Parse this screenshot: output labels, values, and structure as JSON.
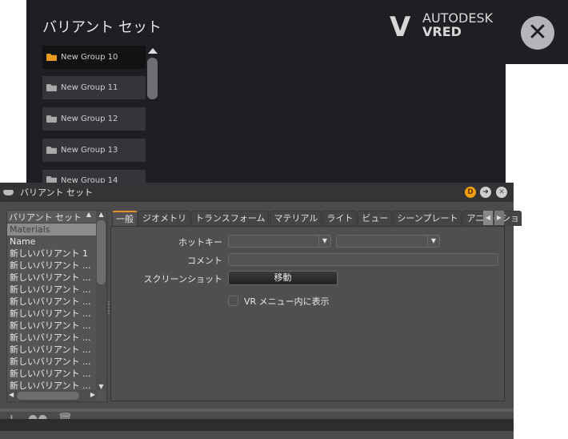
{
  "overlay": {
    "title": "バリアント セット",
    "groups": [
      "New Group 10",
      "New Group 11",
      "New Group 12",
      "New Group 13",
      "New Group 14"
    ],
    "logo": {
      "mark": "V",
      "brand": "AUTODESK",
      "product": "VRED"
    }
  },
  "window": {
    "title": "バリアント セット",
    "buttons": {
      "d": "D",
      "arrow": "➜",
      "close": "✕"
    },
    "list": {
      "header": "バリアント セット",
      "items": [
        "Materials",
        "Name",
        "新しいバリアント 1",
        "新しいバリアント ...",
        "新しいバリアント ...",
        "新しいバリアント ...",
        "新しいバリアント ...",
        "新しいバリアント ...",
        "新しいバリアント ...",
        "新しいバリアント ...",
        "新しいバリアント ...",
        "新しいバリアント ...",
        "新しいバリアント ...",
        "新しいバリアント ...",
        "新しいバリアント ..."
      ]
    },
    "tabs": [
      "一般",
      "ジオメトリ",
      "トランスフォーム",
      "マテリアル",
      "ライト",
      "ビュー",
      "シーンプレート",
      "アニメーション"
    ],
    "form": {
      "hotkey_label": "ホットキー",
      "comment_label": "コメント",
      "screenshot_label": "スクリーンショット",
      "screenshot_button": "移動",
      "vr_checkbox": "VR メニュー内に表示"
    },
    "toolbar": {
      "add": "+",
      "link": "●●",
      "delete": "🗑"
    }
  }
}
